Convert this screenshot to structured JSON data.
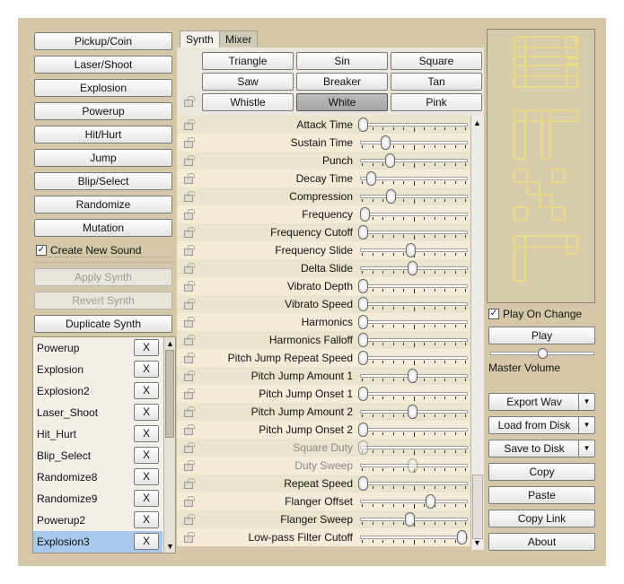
{
  "generators": [
    "Pickup/Coin",
    "Laser/Shoot",
    "Explosion",
    "Powerup",
    "Hit/Hurt",
    "Jump",
    "Blip/Select",
    "Randomize",
    "Mutation"
  ],
  "create_new_sound": {
    "label": "Create New Sound",
    "checked": true
  },
  "synth_actions": [
    {
      "label": "Apply Synth",
      "enabled": false
    },
    {
      "label": "Revert Synth",
      "enabled": false
    },
    {
      "label": "Duplicate Synth",
      "enabled": true
    }
  ],
  "sounds": [
    "Powerup",
    "Explosion",
    "Explosion2",
    "Laser_Shoot",
    "Hit_Hurt",
    "Blip_Select",
    "Randomize8",
    "Randomize9",
    "Powerup2",
    "Explosion3"
  ],
  "selected_sound": "Explosion3",
  "remove_label": "X",
  "tabs": [
    {
      "label": "Synth",
      "active": true
    },
    {
      "label": "Mixer",
      "active": false
    }
  ],
  "waveforms": [
    "Triangle",
    "Sin",
    "Square",
    "Saw",
    "Breaker",
    "Tan",
    "Whistle",
    "White",
    "Pink"
  ],
  "selected_waveform": "White",
  "params": [
    {
      "label": "Attack Time",
      "value": 0.0,
      "enabled": true
    },
    {
      "label": "Sustain Time",
      "value": 0.23,
      "enabled": true
    },
    {
      "label": "Punch",
      "value": 0.27,
      "enabled": true
    },
    {
      "label": "Decay Time",
      "value": 0.08,
      "enabled": true
    },
    {
      "label": "Compression",
      "value": 0.28,
      "enabled": true
    },
    {
      "label": "Frequency",
      "value": 0.02,
      "enabled": true
    },
    {
      "label": "Frequency Cutoff",
      "value": 0.0,
      "enabled": true
    },
    {
      "label": "Frequency Slide",
      "value": 0.48,
      "enabled": true
    },
    {
      "label": "Delta Slide",
      "value": 0.5,
      "enabled": true
    },
    {
      "label": "Vibrato Depth",
      "value": 0.0,
      "enabled": true
    },
    {
      "label": "Vibrato Speed",
      "value": 0.0,
      "enabled": true
    },
    {
      "label": "Harmonics",
      "value": 0.0,
      "enabled": true
    },
    {
      "label": "Harmonics Falloff",
      "value": 0.0,
      "enabled": true
    },
    {
      "label": "Pitch Jump Repeat Speed",
      "value": 0.0,
      "enabled": true
    },
    {
      "label": "Pitch Jump Amount 1",
      "value": 0.5,
      "enabled": true
    },
    {
      "label": "Pitch Jump Onset 1",
      "value": 0.0,
      "enabled": true
    },
    {
      "label": "Pitch Jump Amount 2",
      "value": 0.5,
      "enabled": true
    },
    {
      "label": "Pitch Jump Onset 2",
      "value": 0.0,
      "enabled": true
    },
    {
      "label": "Square Duty",
      "value": 0.0,
      "enabled": false
    },
    {
      "label": "Duty Sweep",
      "value": 0.5,
      "enabled": false
    },
    {
      "label": "Repeat Speed",
      "value": 0.0,
      "enabled": true
    },
    {
      "label": "Flanger Offset",
      "value": 0.68,
      "enabled": true
    },
    {
      "label": "Flanger Sweep",
      "value": 0.47,
      "enabled": true
    },
    {
      "label": "Low-pass Filter Cutoff",
      "value": 1.0,
      "enabled": true
    }
  ],
  "play_on_change": {
    "label": "Play On Change",
    "checked": true
  },
  "play_label": "Play",
  "master_volume": {
    "label": "Master Volume",
    "value": 0.5
  },
  "export_label": "Export Wav",
  "load_label": "Load from Disk",
  "save_label": "Save to Disk",
  "copy_label": "Copy",
  "paste_label": "Paste",
  "copy_link_label": "Copy Link",
  "about_label": "About",
  "logo_color": "#ead98a",
  "accent_select": "#a8c8ec"
}
